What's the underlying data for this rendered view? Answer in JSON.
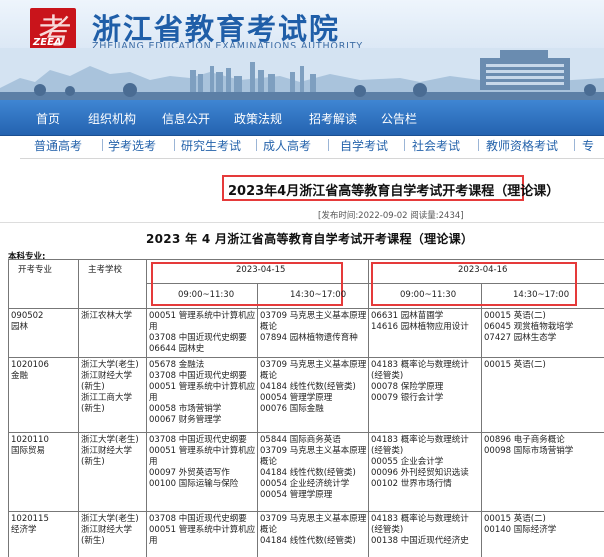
{
  "site": {
    "title": "浙江省教育考试院",
    "subtitle": "ZHEJIANG EDUCATION EXAMINATIONS AUTHORITY",
    "logo_abbr": "ZEEA",
    "logo_glyph": "考"
  },
  "main_nav": [
    "首页",
    "组织机构",
    "信息公开",
    "政策法规",
    "招考解读",
    "公告栏"
  ],
  "sub_nav": [
    "普通高考",
    "学考选考",
    "研究生考试",
    "成人高考",
    "自学考试",
    "社会考试",
    "教师资格考试",
    "专"
  ],
  "article": {
    "title": "2023年4月浙江省高等教育自学考试开考课程（理论课）",
    "meta": "[发布时间:2022-09-02 阅读量:2434]",
    "content_title": "2023 年 4 月浙江省高等教育自学考试开考课程（理论课）",
    "section_label": "本科专业:"
  },
  "table": {
    "col_major": "开考专业",
    "col_school": "主考学校",
    "dates": [
      "2023-04-15",
      "2023-04-16"
    ],
    "times": [
      "09:00~11:30",
      "14:30~17:00",
      "09:00~11:30",
      "14:30~17:00"
    ],
    "rows": [
      {
        "major": [
          "090502",
          "园林"
        ],
        "school": [
          "浙江农林大学"
        ],
        "cells": [
          [
            "00051 管理系统中计算机应",
            "用",
            "03708 中国近现代史纲要",
            "06644 园林史"
          ],
          [
            "03709 马克思主义基本原理",
            "概论",
            "07894 园林植物遗传育种"
          ],
          [
            "06631 园林苗圃学",
            "14616 园林植物应用设计"
          ],
          [
            "00015 英语(二)",
            "06045 观赏植物栽培学",
            "07427 园林生态学"
          ]
        ]
      },
      {
        "major": [
          "1020106",
          "金融"
        ],
        "school": [
          "浙江大学(老生)",
          "浙江财经大学",
          "(新生)",
          "浙江工商大学",
          "(新生)"
        ],
        "cells": [
          [
            "05678 金融法",
            "03708 中国近现代史纲要",
            "00051 管理系统中计算机应",
            "用",
            "00058 市场营销学",
            "00067 财务管理学"
          ],
          [
            "03709 马克思主义基本原理",
            "概论",
            "04184 线性代数(经管类)",
            "00054 管理学原理",
            "00076 国际金融"
          ],
          [
            "04183 概率论与数理统计",
            "(经管类)",
            "00078 保险学原理",
            "00079 银行会计学"
          ],
          [
            "00015 英语(二)"
          ]
        ]
      },
      {
        "major": [
          "1020110",
          "国际贸易"
        ],
        "school": [
          "浙江大学(老生)",
          "浙江财经大学",
          "(新生)"
        ],
        "cells": [
          [
            "03708 中国近现代史纲要",
            "00051 管理系统中计算机应",
            "用",
            "00097 外贸英语写作",
            "00100 国际运输与保险"
          ],
          [
            "05844 国际商务英语",
            "03709 马克思主义基本原理",
            "概论",
            "04184 线性代数(经管类)",
            "00054 企业经济统计学",
            "00054 管理学原理"
          ],
          [
            "04183 概率论与数理统计",
            "(经管类)",
            "00055 企业会计学",
            "00096 外刊经贸知识选读",
            "00102 世界市场行情"
          ],
          [
            "00896 电子商务概论",
            "00098 国际市场营销学"
          ]
        ]
      },
      {
        "major": [
          "1020115",
          "经济学"
        ],
        "school": [
          "浙江大学(老生)",
          "浙江财经大学",
          "(新生)"
        ],
        "cells": [
          [
            "03708 中国近现代史纲要",
            "00051 管理系统中计算机应",
            "用"
          ],
          [
            "03709 马克思主义基本原理",
            "概论",
            "04184 线性代数(经管类)"
          ],
          [
            "04183 概率论与数理统计",
            "(经管类)",
            "00138 中国近现代经济史"
          ],
          [
            "00015 英语(二)",
            "00140 国际经济学"
          ]
        ]
      }
    ]
  }
}
